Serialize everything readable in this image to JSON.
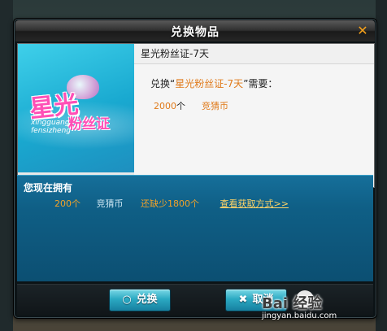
{
  "dialog": {
    "title": "兑换物品",
    "close_symbol": "✕"
  },
  "item": {
    "name": "星光粉丝证-7天",
    "exchange_prefix": "兑换“",
    "exchange_item": "星光粉丝证-7天",
    "exchange_suffix": "”需要：",
    "cost_amount": "2000",
    "cost_unit_label": "个",
    "cost_currency": "竞猜币",
    "image_text_main": "星光",
    "image_text_sub": "粉丝证",
    "image_text_pinyin1": "xingguang",
    "image_text_pinyin2": "fensizheng"
  },
  "owned": {
    "header": "您现在拥有",
    "amount": "200个",
    "currency": "竞猜币",
    "shortage": "还缺少1800个",
    "link": "查看获取方式>>"
  },
  "buttons": {
    "confirm_label": "兑换",
    "confirm_icon": "○",
    "cancel_label": "取消",
    "cancel_icon": "✖"
  },
  "watermark": {
    "brand": "Bai 经验",
    "url": "jingyan.baidu.com"
  },
  "colors": {
    "accent_orange": "#e07a1a",
    "button_teal": "#2ba9c2",
    "panel_blue": "#0f5f86"
  }
}
